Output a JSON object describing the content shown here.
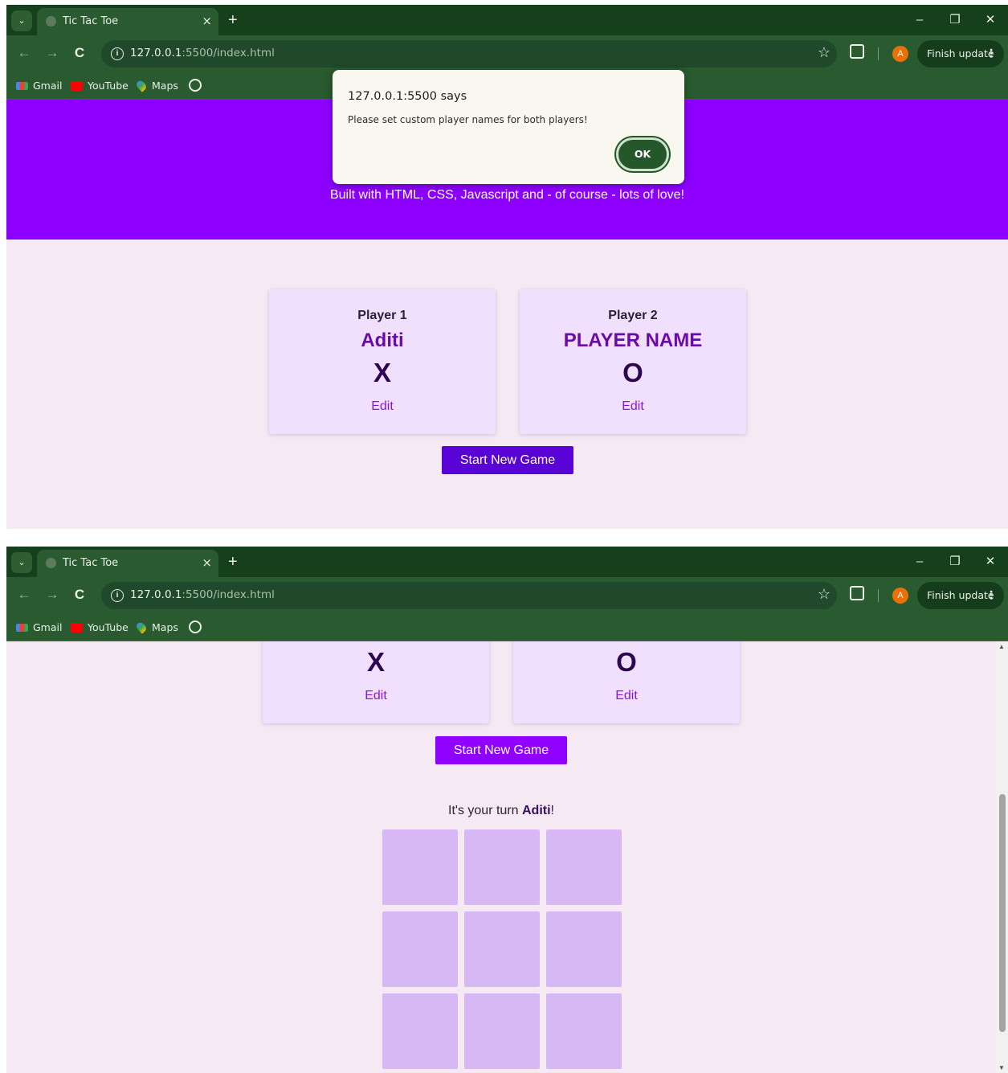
{
  "browser": {
    "tab_title": "Tic Tac Toe",
    "tab_close": "×",
    "new_tab": "+",
    "url_host": "127.0.0.1",
    "url_rest": ":5500/index.html",
    "avatar_letter": "A",
    "update_label": "Finish update",
    "bookmarks": [
      "Gmail",
      "YouTube",
      "Maps"
    ],
    "window_controls": [
      "–",
      "❐",
      "✕"
    ]
  },
  "screen1": {
    "tagline": "Built with HTML, CSS, Javascript and - of course - lots of love!",
    "dialog": {
      "title": "127.0.0.1:5500 says",
      "message": "Please set custom player names for both players!",
      "ok_label": "OK"
    },
    "players": [
      {
        "heading": "Player 1",
        "name": "Aditi",
        "symbol": "X",
        "edit_label": "Edit"
      },
      {
        "heading": "Player 2",
        "name": "PLAYER NAME",
        "symbol": "O",
        "edit_label": "Edit"
      }
    ],
    "start_label": "Start New Game",
    "start_color": "#5a03d6"
  },
  "screen2": {
    "players": [
      {
        "symbol": "X",
        "edit_label": "Edit"
      },
      {
        "symbol": "O",
        "edit_label": "Edit"
      }
    ],
    "start_label": "Start New Game",
    "start_color": "#8f00ff",
    "turn_prefix": "It's your turn ",
    "turn_player": "Aditi",
    "turn_suffix": "!",
    "board": [
      "",
      "",
      "",
      "",
      "",
      "",
      "",
      "",
      ""
    ]
  },
  "colors": {
    "chrome_dark": "#16401c",
    "chrome": "#2a5a2f",
    "banner": "#8d00ff",
    "page_bg": "#f5e9f4",
    "card_bg": "#f0e0fd",
    "cell_bg": "#d8b8f4"
  }
}
